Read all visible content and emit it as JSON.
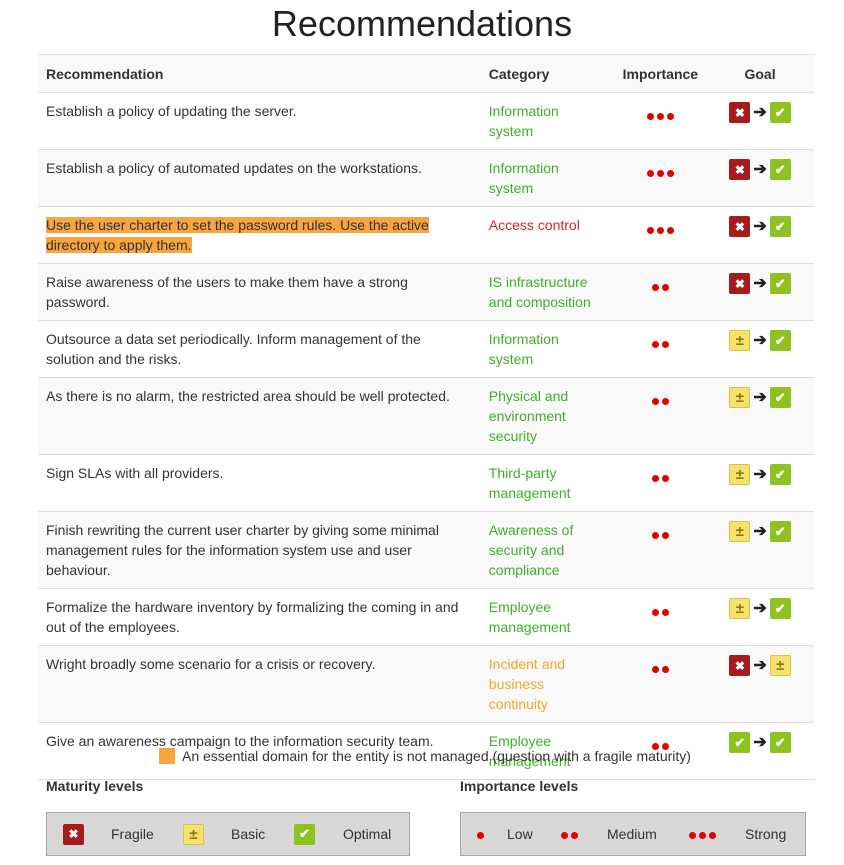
{
  "page": {
    "title": "Recommendations"
  },
  "table": {
    "headers": [
      "Recommendation",
      "Category",
      "Importance",
      "Goal"
    ],
    "rows": [
      {
        "text": "Establish a policy of updating the server.",
        "category": "Information system",
        "cat_color": "green",
        "importance": 3,
        "from": "fragile",
        "to": "optimal",
        "highlight": false
      },
      {
        "text": "Establish a policy of automated updates on the workstations.",
        "category": "Information system",
        "cat_color": "green",
        "importance": 3,
        "from": "fragile",
        "to": "optimal",
        "highlight": false
      },
      {
        "text": "Use the user charter to set the password rules. Use the active directory to apply them.",
        "category": "Access control",
        "cat_color": "red",
        "importance": 3,
        "from": "fragile",
        "to": "optimal",
        "highlight": true
      },
      {
        "text": "Raise awareness of the users to make them have a strong password.",
        "category": "IS infrastructure and composition",
        "cat_color": "green",
        "importance": 2,
        "from": "fragile",
        "to": "optimal",
        "highlight": false
      },
      {
        "text": "Outsource a data set periodically. Inform management of the solution and the risks.",
        "category": "Information system",
        "cat_color": "green",
        "importance": 2,
        "from": "basic",
        "to": "optimal",
        "highlight": false
      },
      {
        "text": "As there is no alarm, the restricted area should be well protected.",
        "category": "Physical and environment security",
        "cat_color": "green",
        "importance": 2,
        "from": "basic",
        "to": "optimal",
        "highlight": false
      },
      {
        "text": "Sign SLAs with all providers.",
        "category": "Third-party management",
        "cat_color": "green",
        "importance": 2,
        "from": "basic",
        "to": "optimal",
        "highlight": false
      },
      {
        "text": "Finish rewriting the current user charter by giving some minimal management rules for the information system use and user behaviour.",
        "category": "Awareness of security and compliance",
        "cat_color": "green",
        "importance": 2,
        "from": "basic",
        "to": "optimal",
        "highlight": false
      },
      {
        "text": "Formalize the hardware inventory by formalizing the coming in and out of the employees.",
        "category": "Employee management",
        "cat_color": "green",
        "importance": 2,
        "from": "basic",
        "to": "optimal",
        "highlight": false
      },
      {
        "text": "Wright broadly some scenario for a crisis or recovery.",
        "category": "Incident and business continuity",
        "cat_color": "orange",
        "importance": 2,
        "from": "fragile",
        "to": "basic",
        "highlight": false
      },
      {
        "text": "Give an awareness campaign to the information security team.",
        "category": "Employee management",
        "cat_color": "green",
        "importance": 2,
        "from": "optimal",
        "to": "optimal",
        "highlight": false
      }
    ]
  },
  "legend": {
    "note": "An essential domain for the entity is not managed (question with a fragile maturity)",
    "note_color": "#f6a53f"
  },
  "maturity": {
    "title": "Maturity levels",
    "items": [
      {
        "key": "fragile",
        "label": "Fragile"
      },
      {
        "key": "basic",
        "label": "Basic"
      },
      {
        "key": "optimal",
        "label": "Optimal"
      }
    ]
  },
  "importance": {
    "title": "Importance levels",
    "items": [
      {
        "dots": 1,
        "label": "Low"
      },
      {
        "dots": 2,
        "label": "Medium"
      },
      {
        "dots": 3,
        "label": "Strong"
      }
    ]
  },
  "colors": {
    "fragile": "#a61c1c",
    "basic": "#f5e16b",
    "optimal": "#8ec21f",
    "category_green": "#3fae2a",
    "category_red": "#e02020",
    "category_orange": "#f6a623",
    "importance_dot": "#e00000"
  },
  "icons": {
    "fragile": "x-icon",
    "basic": "plus-minus-icon",
    "optimal": "check-icon",
    "arrow": "arrow-right-icon"
  }
}
